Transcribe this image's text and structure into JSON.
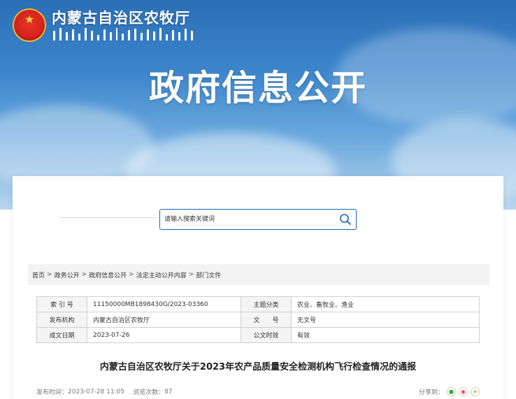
{
  "header": {
    "site_title": "内蒙古自治区农牧厅",
    "hero_title": "政府信息公开"
  },
  "search": {
    "placeholder": "请输入搜索关键词"
  },
  "breadcrumb": [
    "首页",
    "政务公开",
    "政府信息公开",
    "法定主动公开内容",
    "部门文件"
  ],
  "info": {
    "index_label": "索 引 号",
    "index_value": "11150000MB1898430G/2023-03360",
    "topic_label": "主题分类",
    "topic_value": "农业、畜牧业、渔业",
    "issuer_label": "发布机构",
    "issuer_value": "内蒙古自治区农牧厅",
    "docno_label": "文　　号",
    "docno_value": "无文号",
    "date_label": "成文日期",
    "date_value": "2023-07-26",
    "validity_label": "公文时效",
    "validity_value": "有效"
  },
  "document": {
    "title": "内蒙古自治区农牧厅关于2023年农产品质量安全检测机构飞行检查情况的通报",
    "publish_label": "发布时间：",
    "publish_time": "2023-07-28 11:05",
    "views_label": "浏览次数：",
    "views_count": "87",
    "share_label": "分享到："
  },
  "colors": {
    "accent": "#1b65b3",
    "banner_top": "#2a6fb6"
  },
  "icons": [
    "national-emblem-icon",
    "search-icon",
    "wechat-icon",
    "weibo-icon",
    "favorite-icon"
  ]
}
